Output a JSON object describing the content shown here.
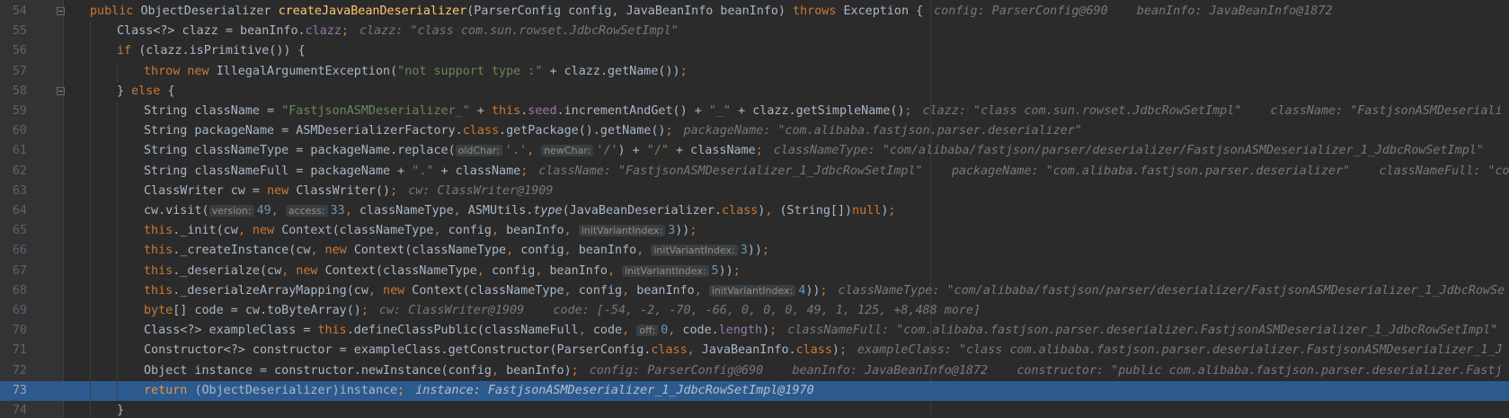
{
  "editor": {
    "current_line": "73",
    "lines": [
      {
        "n": "54",
        "p": [
          [
            "kw",
            "public "
          ],
          [
            "",
            "ObjectDeserializer "
          ],
          [
            "fn",
            "createJavaBeanDeserializer"
          ],
          [
            "",
            "(ParserConfig config, JavaBeanInfo beanInfo) "
          ],
          [
            "kw",
            "throws "
          ],
          [
            "",
            "Exception {"
          ],
          [
            "dbg",
            "config: ParserConfig@690    beanInfo: JavaBeanInfo@1872"
          ]
        ]
      },
      {
        "n": "55",
        "p": [
          [
            "",
            "Class<?> clazz = beanInfo."
          ],
          [
            "field",
            "clazz"
          ],
          [
            "kw",
            ";"
          ],
          [
            "dbg",
            "clazz: \"class com.sun.rowset.JdbcRowSetImpl\""
          ]
        ]
      },
      {
        "n": "56",
        "p": [
          [
            "kw",
            "if "
          ],
          [
            "",
            "(clazz.isPrimitive()) {"
          ]
        ]
      },
      {
        "n": "57",
        "p": [
          [
            "kw",
            "throw new "
          ],
          [
            "",
            "IllegalArgumentException("
          ],
          [
            "str",
            "\"not support type :\""
          ],
          [
            "",
            " + clazz.getName())"
          ],
          [
            "kw",
            ";"
          ]
        ]
      },
      {
        "n": "58",
        "p": [
          [
            "",
            "} "
          ],
          [
            "kw",
            "else "
          ],
          [
            "",
            "{"
          ]
        ]
      },
      {
        "n": "59",
        "p": [
          [
            "",
            "String className = "
          ],
          [
            "str",
            "\"FastjsonASMDeserializer_\""
          ],
          [
            "",
            " + "
          ],
          [
            "kw",
            "this"
          ],
          [
            "",
            "."
          ],
          [
            "field",
            "seed"
          ],
          [
            "",
            ".incrementAndGet() + "
          ],
          [
            "str",
            "\"_\""
          ],
          [
            "",
            " + clazz.getSimpleName()"
          ],
          [
            "kw",
            ";"
          ],
          [
            "dbg",
            "clazz: \"class com.sun.rowset.JdbcRowSetImpl\"    className: \"FastjsonASMDeseriali"
          ]
        ]
      },
      {
        "n": "60",
        "p": [
          [
            "",
            "String packageName = ASMDeserializerFactory."
          ],
          [
            "kw",
            "class"
          ],
          [
            "",
            ".getPackage().getName()"
          ],
          [
            "kw",
            ";"
          ],
          [
            "dbg",
            "packageName: \"com.alibaba.fastjson.parser.deserializer\""
          ]
        ]
      },
      {
        "n": "61",
        "p": [
          [
            "",
            "String classNameType = packageName.replace("
          ],
          [
            "hint",
            "oldChar:"
          ],
          [
            "str",
            "'.'"
          ],
          [
            "kw",
            ", "
          ],
          [
            "hint",
            "newChar:"
          ],
          [
            "str",
            "'/'"
          ],
          [
            "",
            ") + "
          ],
          [
            "str",
            "\"/\""
          ],
          [
            "",
            " + className"
          ],
          [
            "kw",
            ";"
          ],
          [
            "dbg",
            "classNameType: \"com/alibaba/fastjson/parser/deserializer/FastjsonASMDeserializer_1_JdbcRowSetImpl\""
          ]
        ]
      },
      {
        "n": "62",
        "p": [
          [
            "",
            "String classNameFull = packageName + "
          ],
          [
            "str",
            "\".\""
          ],
          [
            "",
            " + className"
          ],
          [
            "kw",
            ";"
          ],
          [
            "dbg",
            "className: \"FastjsonASMDeserializer_1_JdbcRowSetImpl\"    packageName: \"com.alibaba.fastjson.parser.deserializer\"    classNameFull: \"co"
          ]
        ]
      },
      {
        "n": "63",
        "p": [
          [
            "",
            "ClassWriter cw = "
          ],
          [
            "kw",
            "new "
          ],
          [
            "",
            "ClassWriter()"
          ],
          [
            "kw",
            ";"
          ],
          [
            "dbg",
            "cw: ClassWriter@1909"
          ]
        ]
      },
      {
        "n": "64",
        "p": [
          [
            "",
            "cw.visit("
          ],
          [
            "hint",
            "version:"
          ],
          [
            "num",
            "49"
          ],
          [
            "kw",
            ", "
          ],
          [
            "hint",
            "access:"
          ],
          [
            "num",
            "33"
          ],
          [
            "kw",
            ", "
          ],
          [
            "",
            "classNameType"
          ],
          [
            "kw",
            ", "
          ],
          [
            "",
            "ASMUtils."
          ],
          [
            "st",
            "type"
          ],
          [
            "",
            "(JavaBeanDeserializer."
          ],
          [
            "kw",
            "class"
          ],
          [
            "",
            ")"
          ],
          [
            "kw",
            ", "
          ],
          [
            "",
            "(String[])"
          ],
          [
            "kw",
            "null"
          ],
          [
            "",
            ")"
          ],
          [
            "kw",
            ";"
          ]
        ]
      },
      {
        "n": "65",
        "p": [
          [
            "kw",
            "this"
          ],
          [
            "",
            "._init(cw"
          ],
          [
            "kw",
            ", new "
          ],
          [
            "",
            "Context(classNameType"
          ],
          [
            "kw",
            ", "
          ],
          [
            "",
            "config"
          ],
          [
            "kw",
            ", "
          ],
          [
            "",
            "beanInfo"
          ],
          [
            "kw",
            ", "
          ],
          [
            "hint",
            "initVariantIndex:"
          ],
          [
            "num",
            "3"
          ],
          [
            "",
            "))"
          ],
          [
            "kw",
            ";"
          ]
        ]
      },
      {
        "n": "66",
        "p": [
          [
            "kw",
            "this"
          ],
          [
            "",
            "._createInstance(cw"
          ],
          [
            "kw",
            ", new "
          ],
          [
            "",
            "Context(classNameType"
          ],
          [
            "kw",
            ", "
          ],
          [
            "",
            "config"
          ],
          [
            "kw",
            ", "
          ],
          [
            "",
            "beanInfo"
          ],
          [
            "kw",
            ", "
          ],
          [
            "hint",
            "initVariantIndex:"
          ],
          [
            "num",
            "3"
          ],
          [
            "",
            "))"
          ],
          [
            "kw",
            ";"
          ]
        ]
      },
      {
        "n": "67",
        "p": [
          [
            "kw",
            "this"
          ],
          [
            "",
            "._deserialze(cw"
          ],
          [
            "kw",
            ", new "
          ],
          [
            "",
            "Context(classNameType"
          ],
          [
            "kw",
            ", "
          ],
          [
            "",
            "config"
          ],
          [
            "kw",
            ", "
          ],
          [
            "",
            "beanInfo"
          ],
          [
            "kw",
            ", "
          ],
          [
            "hint",
            "initVariantIndex:"
          ],
          [
            "num",
            "5"
          ],
          [
            "",
            "))"
          ],
          [
            "kw",
            ";"
          ]
        ]
      },
      {
        "n": "68",
        "p": [
          [
            "kw",
            "this"
          ],
          [
            "",
            "._deserialzeArrayMapping(cw"
          ],
          [
            "kw",
            ", new "
          ],
          [
            "",
            "Context(classNameType"
          ],
          [
            "kw",
            ", "
          ],
          [
            "",
            "config"
          ],
          [
            "kw",
            ", "
          ],
          [
            "",
            "beanInfo"
          ],
          [
            "kw",
            ", "
          ],
          [
            "hint",
            "initVariantIndex:"
          ],
          [
            "num",
            "4"
          ],
          [
            "",
            "))"
          ],
          [
            "kw",
            ";"
          ],
          [
            "dbg",
            "classNameType: \"com/alibaba/fastjson/parser/deserializer/FastjsonASMDeserializer_1_JdbcRowSe"
          ]
        ]
      },
      {
        "n": "69",
        "p": [
          [
            "kw",
            "byte"
          ],
          [
            "",
            "[] code = cw.toByteArray()"
          ],
          [
            "kw",
            ";"
          ],
          [
            "dbg",
            "cw: ClassWriter@1909    code: [-54, -2, -70, -66, 0, 0, 0, 49, 1, 125, +8,488 more]"
          ]
        ]
      },
      {
        "n": "70",
        "p": [
          [
            "",
            "Class<?> exampleClass = "
          ],
          [
            "kw",
            "this"
          ],
          [
            "",
            ".defineClassPublic(classNameFull"
          ],
          [
            "kw",
            ", "
          ],
          [
            "",
            "code"
          ],
          [
            "kw",
            ", "
          ],
          [
            "hint",
            "off:"
          ],
          [
            "num",
            "0"
          ],
          [
            "kw",
            ", "
          ],
          [
            "",
            "code."
          ],
          [
            "field",
            "length"
          ],
          [
            "",
            ")"
          ],
          [
            "kw",
            ";"
          ],
          [
            "dbg",
            "classNameFull: \"com.alibaba.fastjson.parser.deserializer.FastjsonASMDeserializer_1_JdbcRowSetImpl\""
          ]
        ]
      },
      {
        "n": "71",
        "p": [
          [
            "",
            "Constructor<?> constructor = exampleClass.getConstructor(ParserConfig."
          ],
          [
            "kw",
            "class"
          ],
          [
            "kw",
            ", "
          ],
          [
            "",
            "JavaBeanInfo."
          ],
          [
            "kw",
            "class"
          ],
          [
            "",
            ")"
          ],
          [
            "kw",
            ";"
          ],
          [
            "dbg",
            "exampleClass: \"class com.alibaba.fastjson.parser.deserializer.FastjsonASMDeserializer_1_J"
          ]
        ]
      },
      {
        "n": "72",
        "p": [
          [
            "",
            "Object instance = constructor.newInstance(config"
          ],
          [
            "kw",
            ", "
          ],
          [
            "",
            "beanInfo)"
          ],
          [
            "kw",
            ";"
          ],
          [
            "dbg",
            "config: ParserConfig@690    beanInfo: JavaBeanInfo@1872    constructor: \"public com.alibaba.fastjson.parser.deserializer.Fastj"
          ]
        ]
      },
      {
        "n": "73",
        "p": [
          [
            "kw",
            "return "
          ],
          [
            "",
            "(ObjectDeserializer)instance"
          ],
          [
            "kw",
            ";"
          ],
          [
            "dbg",
            "instance: FastjsonASMDeserializer_1_JdbcRowSetImpl@1970"
          ]
        ]
      },
      {
        "n": "74",
        "p": [
          [
            "",
            "}"
          ]
        ]
      }
    ]
  }
}
